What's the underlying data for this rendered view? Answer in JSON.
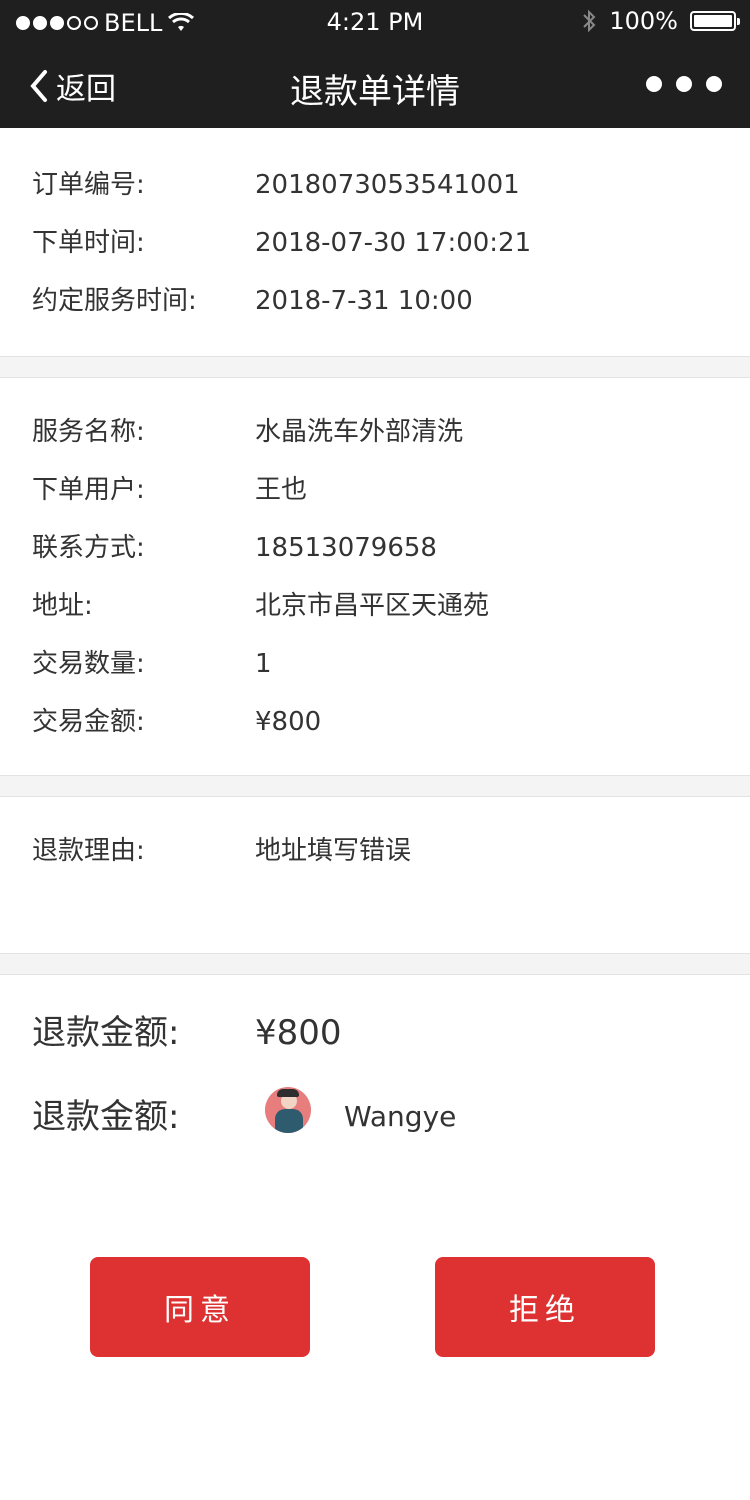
{
  "status_bar": {
    "carrier": "BELL",
    "time": "4:21 PM",
    "battery": "100%",
    "signal_filled": 3,
    "signal_total": 5,
    "icons": [
      "wifi-icon",
      "bluetooth-icon",
      "battery-icon"
    ]
  },
  "nav": {
    "back_label": "返回",
    "title": "退款单详情",
    "more_icon": "more-dots-icon"
  },
  "order_info": {
    "order_no_label": "订单编号:",
    "order_no": "2018073053541001",
    "order_time_label": "下单时间:",
    "order_time": "2018-07-30 17:00:21",
    "service_time_label": "约定服务时间:",
    "service_time": "2018-7-31 10:00"
  },
  "detail_info": {
    "service_name_label": "服务名称:",
    "service_name": "水晶洗车外部清洗",
    "user_label": "下单用户:",
    "user": "王也",
    "contact_label": "联系方式:",
    "contact": "18513079658",
    "address_label": "地址:",
    "address": "北京市昌平区天通苑",
    "quantity_label": "交易数量:",
    "quantity": "1",
    "amount_label": "交易金额:",
    "amount": "¥800"
  },
  "refund_reason": {
    "label": "退款理由:",
    "value": "地址填写错误"
  },
  "refund_summary": {
    "amount_label": "退款金额:",
    "amount": "¥800",
    "account_label": "退款金额:",
    "account_name": "Wangye"
  },
  "actions": {
    "agree": "同意",
    "reject": "拒绝"
  },
  "colors": {
    "header_bg": "#1f1f1f",
    "button_bg": "#de3131",
    "separator": "#f4f4f4"
  }
}
